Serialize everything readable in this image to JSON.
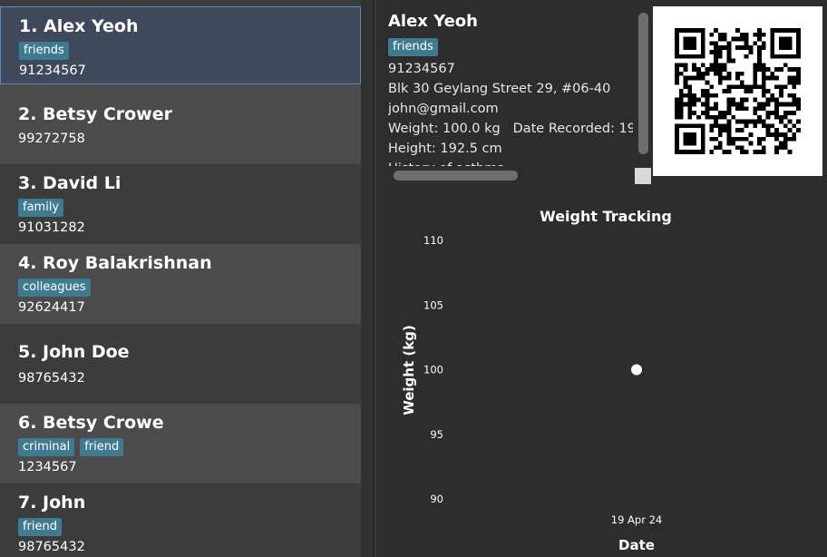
{
  "persons": [
    {
      "index": "1.",
      "name": "Alex Yeoh",
      "tags": [
        "friends"
      ],
      "phone": "91234567",
      "selected": true
    },
    {
      "index": "2.",
      "name": "Betsy Crower",
      "tags": [],
      "phone": "99272758"
    },
    {
      "index": "3.",
      "name": "David Li",
      "tags": [
        "family"
      ],
      "phone": "91031282"
    },
    {
      "index": "4.",
      "name": "Roy Balakrishnan",
      "tags": [
        "colleagues"
      ],
      "phone": "92624417"
    },
    {
      "index": "5.",
      "name": "John Doe",
      "tags": [],
      "phone": "98765432"
    },
    {
      "index": "6.",
      "name": "Betsy Crowe",
      "tags": [
        "criminal",
        "friend"
      ],
      "phone": "1234567"
    },
    {
      "index": "7.",
      "name": "John",
      "tags": [
        "friend"
      ],
      "phone": "98765432"
    }
  ],
  "detail": {
    "name": "Alex Yeoh",
    "tag": "friends",
    "phone": "91234567",
    "address": "Blk 30 Geylang Street 29, #06-40",
    "email": "john@gmail.com",
    "weight": "Weight: 100.0 kg",
    "date_recorded": "Date Recorded: 19",
    "height": "Height: 192.5 cm",
    "history": "History of asthma"
  },
  "colors": {
    "row_odd": "#4b4b4b",
    "row_even": "#3c3c3c",
    "row_selected": "#3e4a5c",
    "tag": "#3e7b91"
  },
  "chart_data": {
    "type": "scatter",
    "title": "Weight Tracking",
    "xlabel": "Date",
    "ylabel": "Weight (kg)",
    "x": [
      "19 Apr 24"
    ],
    "y": [
      100
    ],
    "ylim": [
      90,
      110
    ],
    "yticks": [
      90,
      95,
      100,
      105,
      110
    ],
    "grid": false
  }
}
